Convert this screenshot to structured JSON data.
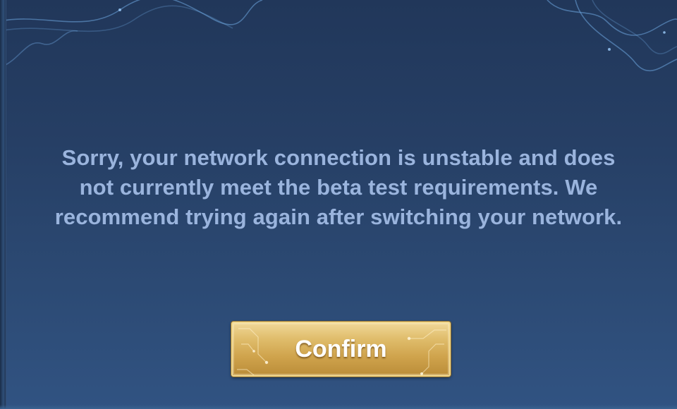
{
  "dialog": {
    "message_lines": [
      "Sorry, your network connection is unstable and does",
      "not currently meet the beta test requirements. We",
      "recommend trying again after switching your network."
    ],
    "confirm_label": "Confirm"
  },
  "icons": {
    "corner_ornaments": "wavy-line-ornament",
    "button_decor": "circuit-line-ornament"
  },
  "colors": {
    "background": "#263f65",
    "message_text": "#9ab4dd",
    "button_gold": "#d8b25e",
    "ornament_glow": "#7fb6ec"
  }
}
